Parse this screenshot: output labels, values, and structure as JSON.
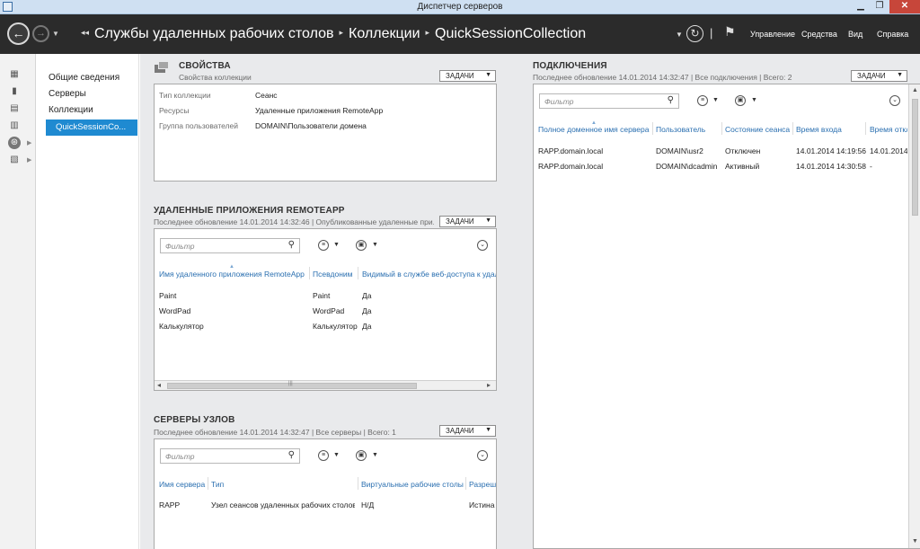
{
  "window": {
    "title": "Диспетчер серверов",
    "minimize": "▁",
    "maximize": "❐",
    "close": "✕"
  },
  "header": {
    "nav_back_glyph": "←",
    "nav_fwd_glyph": "→",
    "nav_drop_glyph": "▼",
    "breadcrumb_prefix": "◂◂",
    "breadcrumb": [
      "Службы удаленных рабочих столов",
      "Коллекции",
      "QuickSessionCollection"
    ],
    "breadcrumb_sep": "▸",
    "menus": [
      "Управление",
      "Средства",
      "Вид",
      "Справка"
    ],
    "icons": {
      "dropdown": "chevron-down-icon",
      "refresh": "refresh-icon",
      "flag": "notifications-flag-icon"
    }
  },
  "rail": {
    "icons": [
      "dashboard-icon",
      "local-server-icon",
      "all-servers-icon",
      "file-services-icon",
      "remote-desktop-icon",
      "roles-icon"
    ]
  },
  "nav": {
    "items": [
      "Общие сведения",
      "Серверы",
      "Коллекции"
    ],
    "selected": "QuickSessionCo..."
  },
  "properties": {
    "title": "СВОЙСТВА",
    "subtitle": "Свойства коллекции",
    "tasks": "ЗАДАЧИ",
    "rows": [
      {
        "key": "Тип коллекции",
        "value": "Сеанс"
      },
      {
        "key": "Ресурсы",
        "value": "Удаленные приложения RemoteApp"
      },
      {
        "key": "Группа пользователей",
        "value": "DOMAIN\\Пользователи домена"
      }
    ]
  },
  "remoteapp": {
    "title": "УДАЛЕННЫЕ ПРИЛОЖЕНИЯ REMOTEAPP",
    "subtitle": "Последнее обновление 14.01.2014 14:32:46 | Опубликованные удаленные при...",
    "tasks": "ЗАДАЧИ",
    "filter_placeholder": "Фильтр",
    "columns": [
      "Имя удаленного приложения RemoteApp",
      "Псевдоним",
      "Видимый в службе веб-доступа к удаленным рабочим столам"
    ],
    "rows": [
      [
        "Paint",
        "Paint",
        "Да"
      ],
      [
        "WordPad",
        "WordPad",
        "Да"
      ],
      [
        "Калькулятор",
        "Калькулятор",
        "Да"
      ]
    ]
  },
  "hosts": {
    "title": "СЕРВЕРЫ УЗЛОВ",
    "subtitle": "Последнее обновление 14.01.2014 14:32:47 | Все серверы | Всего: 1",
    "tasks": "ЗАДАЧИ",
    "filter_placeholder": "Фильтр",
    "columns": [
      "Имя сервера",
      "Тип",
      "Виртуальные рабочие столы",
      "Разрешить новые подключения"
    ],
    "rows": [
      [
        "RAPP",
        "Узел сеансов удаленных рабочих столов",
        "Н/Д",
        "Истина"
      ]
    ]
  },
  "connections": {
    "title": "ПОДКЛЮЧЕНИЯ",
    "subtitle": "Последнее обновление 14.01.2014 14:32:47 | Все подключения | Всего: 2",
    "tasks": "ЗАДАЧИ",
    "filter_placeholder": "Фильтр",
    "columns": [
      "Полное доменное имя сервера",
      "Пользователь",
      "Состояние сеанса",
      "Время входа",
      "Время отключения"
    ],
    "rows": [
      [
        "RAPP.domain.local",
        "DOMAIN\\usr2",
        "Отключен",
        "14.01.2014 14:19:56",
        "14.01.2014"
      ],
      [
        "RAPP.domain.local",
        "DOMAIN\\dcadmin",
        "Активный",
        "14.01.2014 14:30:58",
        "-"
      ]
    ]
  }
}
